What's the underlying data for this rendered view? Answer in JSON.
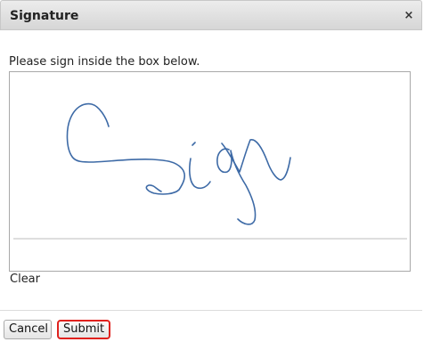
{
  "dialog": {
    "title": "Signature",
    "close_glyph": "×",
    "close_icon": "close-icon",
    "instruction": "Please sign inside the box below.",
    "clear_label": "Clear"
  },
  "footer": {
    "cancel_label": "Cancel",
    "submit_label": "Submit"
  },
  "colors": {
    "stroke": "#3d6aa6",
    "submit_border": "#e0221e"
  }
}
